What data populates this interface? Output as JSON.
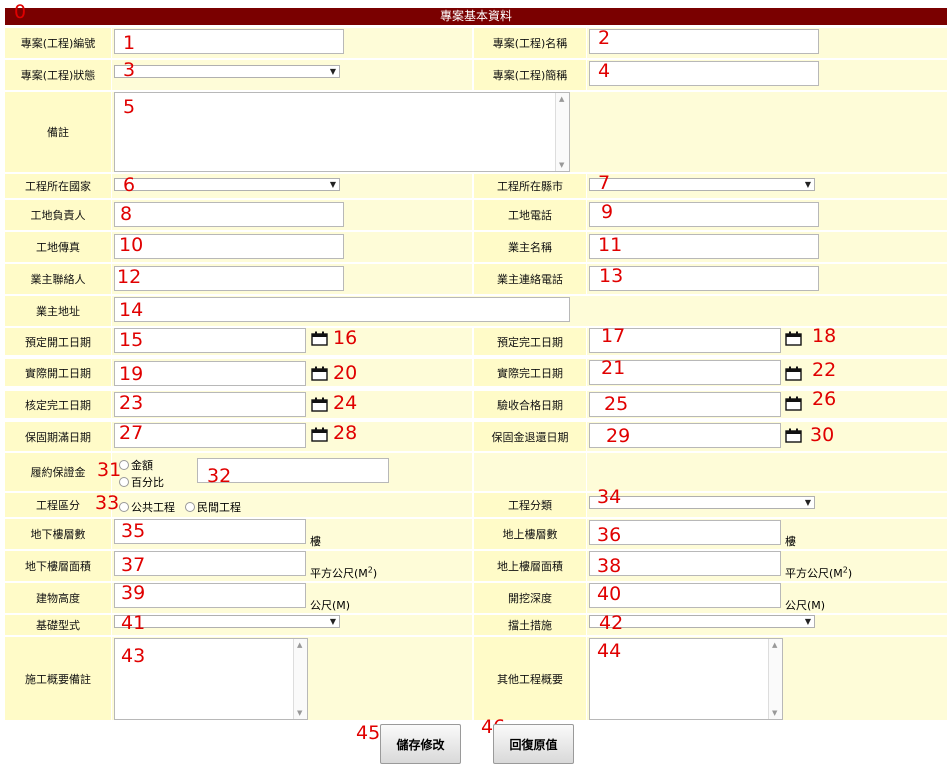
{
  "section_title": "專案基本資料",
  "markers": [
    "0",
    "1",
    "2",
    "3",
    "4",
    "5",
    "6",
    "7",
    "8",
    "9",
    "10",
    "11",
    "12",
    "13",
    "14",
    "15",
    "16",
    "17",
    "18",
    "19",
    "20",
    "21",
    "22",
    "23",
    "24",
    "25",
    "26",
    "27",
    "28",
    "29",
    "30",
    "31",
    "32",
    "33",
    "34",
    "35",
    "36",
    "37",
    "38",
    "39",
    "40",
    "41",
    "42",
    "43",
    "44",
    "45",
    "46"
  ],
  "labels": {
    "project_no": "專案(工程)編號",
    "project_name": "專案(工程)名稱",
    "project_status": "專案(工程)狀態",
    "project_short": "專案(工程)簡稱",
    "remarks": "備註",
    "country": "工程所在國家",
    "city": "工程所在縣市",
    "site_manager": "工地負責人",
    "site_phone": "工地電話",
    "site_fax": "工地傳真",
    "owner_name": "業主名稱",
    "owner_contact": "業主聯絡人",
    "owner_phone": "業主連絡電話",
    "owner_address": "業主地址",
    "planned_start": "預定開工日期",
    "planned_finish": "預定完工日期",
    "actual_start": "實際開工日期",
    "actual_finish": "實際完工日期",
    "approved_finish": "核定完工日期",
    "acceptance_date": "驗收合格日期",
    "warranty_end": "保固期滿日期",
    "warranty_refund": "保固金退還日期",
    "performance_bond": "履約保證金",
    "project_category": "工程區分",
    "project_type": "工程分類",
    "basement_floors": "地下樓層數",
    "above_floors": "地上樓層數",
    "basement_area": "地下樓層面積",
    "above_area": "地上樓層面積",
    "building_height": "建物高度",
    "excavation_depth": "開挖深度",
    "foundation_type": "基礎型式",
    "retaining_measure": "擋土措施",
    "construction_notes": "施工概要備註",
    "other_overview": "其他工程概要"
  },
  "options": {
    "bond_amount": "金額",
    "bond_percent": "百分比",
    "public_works": "公共工程",
    "private_works": "民間工程"
  },
  "units": {
    "floor": "樓",
    "sqm_prefix": "平方公尺(M",
    "sqm_sup": "2",
    "sqm_suffix": ")",
    "meter": "公尺(M)"
  },
  "buttons": {
    "save": "儲存修改",
    "reset": "回復原值"
  }
}
